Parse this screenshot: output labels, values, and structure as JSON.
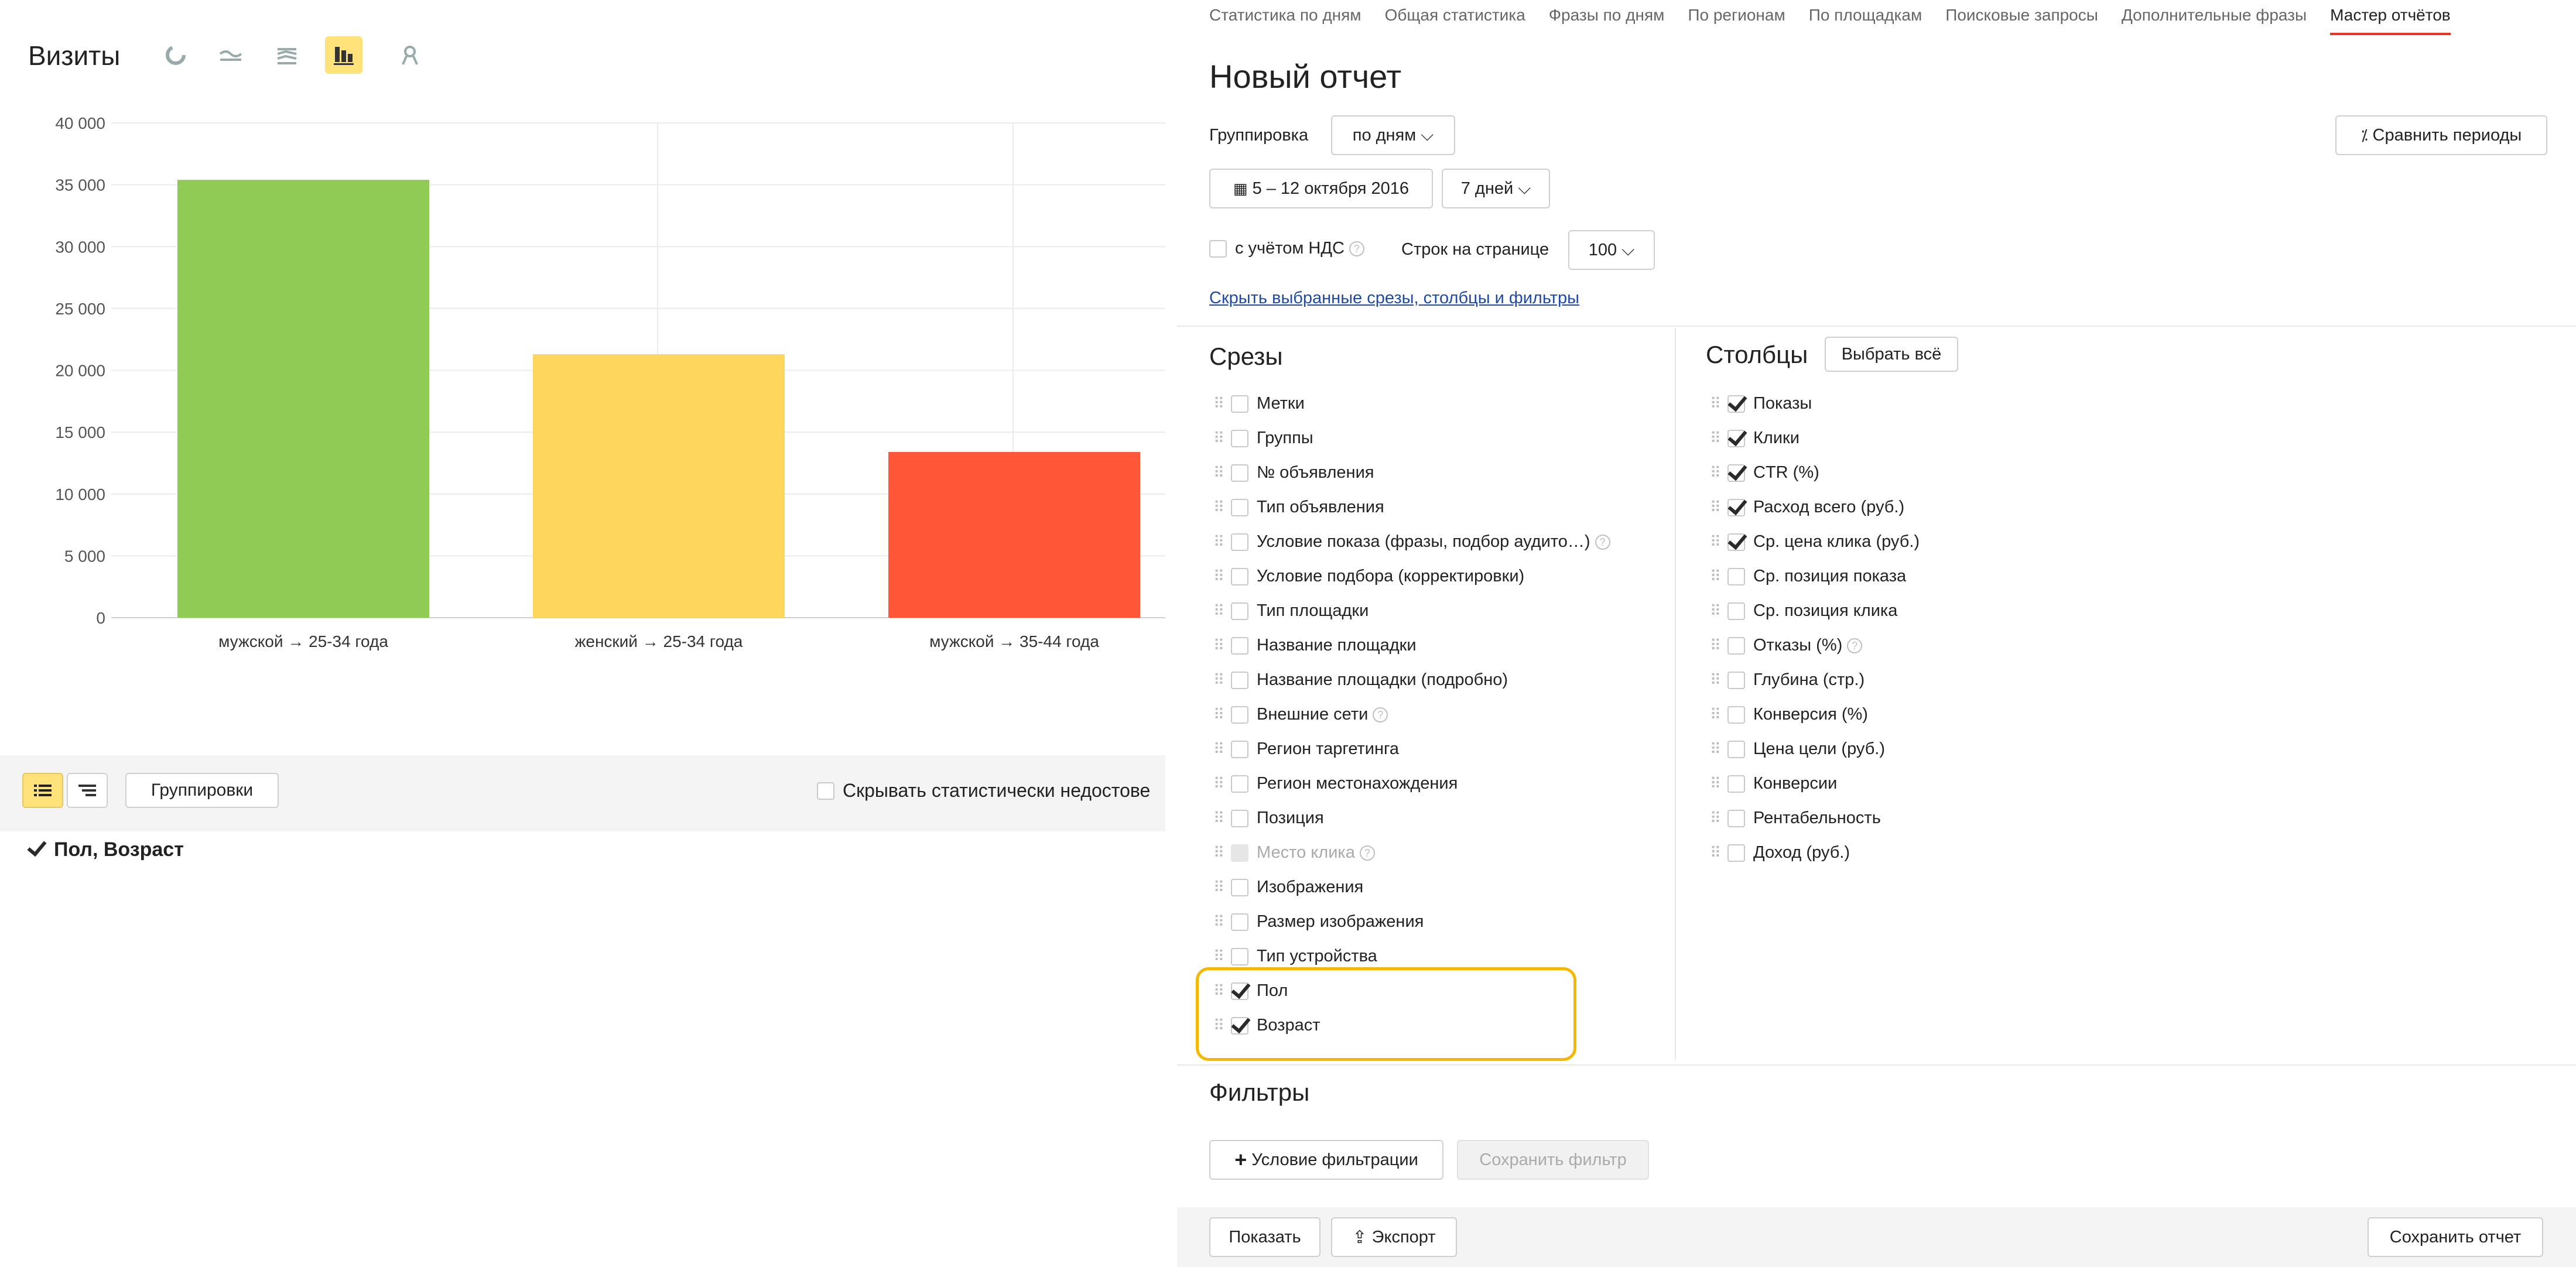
{
  "chart_panel": {
    "title": "Визиты",
    "mode_icons": [
      "pie-chart-icon",
      "line-chart-icon",
      "area-chart-icon",
      "bar-chart-icon",
      "map-pin-icon"
    ],
    "active_mode": "bar-chart-icon"
  },
  "chart_data": {
    "type": "bar",
    "categories": [
      "мужской → 25-34 года",
      "женский → 25-34 года",
      "мужской → 35-44 года"
    ],
    "values": [
      35400,
      21300,
      13400
    ],
    "colors": [
      "#8fcb55",
      "#ffd65c",
      "#ff5737"
    ],
    "ylim": [
      0,
      40000
    ],
    "yticks": [
      "40 000",
      "35 000",
      "30 000",
      "25 000",
      "20 000",
      "15 000",
      "10 000",
      "5 000",
      "0"
    ],
    "grid": true,
    "title": "",
    "xlabel": "",
    "ylabel": ""
  },
  "table_toolbar": {
    "groupings_label": "Группировки",
    "hide_label": "Скрывать статистически недостове"
  },
  "selected_group": "Пол, Возраст",
  "report": {
    "tabs": [
      {
        "label": "Статистика по дням",
        "active": false
      },
      {
        "label": "Общая статистика",
        "active": false
      },
      {
        "label": "Фразы по дням",
        "active": false
      },
      {
        "label": "По регионам",
        "active": false
      },
      {
        "label": "По площадкам",
        "active": false
      },
      {
        "label": "Поисковые запросы",
        "active": false
      },
      {
        "label": "Дополнительные фразы",
        "active": false
      },
      {
        "label": "Мастер отчётов",
        "active": true
      }
    ],
    "title": "Новый отчет",
    "grouping_label": "Группировка",
    "grouping_value": "по дням",
    "compare_label": "Сравнить периоды",
    "date_range": "5 – 12 октября 2016",
    "period": "7 дней",
    "vat_label": "с учётом НДС",
    "rows_label": "Строк на странице",
    "rows_value": "100",
    "hide_link": "Скрыть выбранные срезы, столбцы и фильтры",
    "slices_title": "Срезы",
    "columns_title": "Столбцы",
    "select_all": "Выбрать всё",
    "slices": [
      {
        "label": "Метки",
        "checked": false
      },
      {
        "label": "Группы",
        "checked": false
      },
      {
        "label": "№ объявления",
        "checked": false
      },
      {
        "label": "Тип объявления",
        "checked": false
      },
      {
        "label": "Условие показа (фразы, подбор аудито…)",
        "checked": false,
        "help": true
      },
      {
        "label": "Условие подбора (корректировки)",
        "checked": false
      },
      {
        "label": "Тип площадки",
        "checked": false
      },
      {
        "label": "Название площадки",
        "checked": false
      },
      {
        "label": "Название площадки (подробно)",
        "checked": false
      },
      {
        "label": "Внешние сети",
        "checked": false,
        "help": true
      },
      {
        "label": "Регион таргетинга",
        "checked": false
      },
      {
        "label": "Регион местонахождения",
        "checked": false
      },
      {
        "label": "Позиция",
        "checked": false
      },
      {
        "label": "Место клика",
        "checked": false,
        "help": true,
        "disabled": true
      },
      {
        "label": "Изображения",
        "checked": false
      },
      {
        "label": "Размер изображения",
        "checked": false
      },
      {
        "label": "Тип устройства",
        "checked": false
      },
      {
        "label": "Пол",
        "checked": true
      },
      {
        "label": "Возраст",
        "checked": true
      }
    ],
    "columns": [
      {
        "label": "Показы",
        "checked": true
      },
      {
        "label": "Клики",
        "checked": true
      },
      {
        "label": "CTR (%)",
        "checked": true
      },
      {
        "label": "Расход всего (руб.)",
        "checked": true
      },
      {
        "label": "Ср. цена клика (руб.)",
        "checked": true
      },
      {
        "label": "Ср. позиция показа",
        "checked": false
      },
      {
        "label": "Ср. позиция клика",
        "checked": false
      },
      {
        "label": "Отказы (%)",
        "checked": false,
        "help": true
      },
      {
        "label": "Глубина (стр.)",
        "checked": false
      },
      {
        "label": "Конверсия (%)",
        "checked": false
      },
      {
        "label": "Цена цели (руб.)",
        "checked": false
      },
      {
        "label": "Конверсии",
        "checked": false
      },
      {
        "label": "Рентабельность",
        "checked": false
      },
      {
        "label": "Доход (руб.)",
        "checked": false
      }
    ],
    "filters_title": "Фильтры",
    "add_filter": "Условие фильтрации",
    "save_filter": "Сохранить фильтр",
    "show_btn": "Показать",
    "export_btn": "Экспорт",
    "save_report_btn": "Сохранить отчет"
  }
}
